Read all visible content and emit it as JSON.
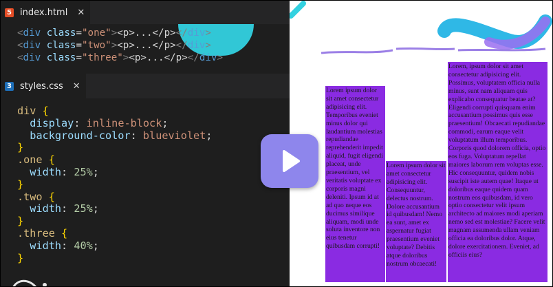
{
  "editor": {
    "tabs": [
      {
        "label": "index.html",
        "icon": "html5-icon",
        "close": "✕"
      },
      {
        "label": "styles.css",
        "icon": "css3-icon",
        "close": "✕"
      }
    ],
    "html_lines": [
      {
        "name": "one",
        "inner": "<p>...</p>"
      },
      {
        "name": "two",
        "inner": "<p>...</p>"
      },
      {
        "name": "three",
        "inner": "<p>...</p>"
      }
    ],
    "css": {
      "div_selector": "div",
      "display_prop": "display",
      "display_value": "inline-block",
      "bg_prop": "background-color",
      "bg_value": "blueviolet",
      "rules": [
        {
          "selector": ".one",
          "prop": "width",
          "value": "25%"
        },
        {
          "selector": ".two",
          "prop": "width",
          "value": "25%"
        },
        {
          "selector": ".three",
          "prop": "width",
          "value": "40%"
        }
      ]
    }
  },
  "preview": {
    "box_color": "#8a2be2",
    "boxes": [
      {
        "text": "Lorem ipsum dolor sit amet consectetur adipisicing elit. Temporibus eveniet minus dolor qui laudantium molestias repudiandae reprehenderit impedit aliquid, fugit eligendi placeat, unde praesentium, vel veritatis voluptate ex corporis magni deleniti. Ipsum id at ad quo neque eos ducimus similique aliquam, modi unde soluta inventore non eius tenetur quibusdam corrupti!"
      },
      {
        "text": "Lorem ipsum dolor sit amet consectetur adipisicing elit. Consequuntur, delectus nostrum. Dolore accusantium id quibusdam! Nemo ea sunt, amet ex aspernatur fugiat praesentium eveniet voluptate? Debitis atque doloribus nostrum obcaecati!"
      },
      {
        "text": "Lorem, ipsum dolor sit amet consectetur adipisicing elit. Possimus, voluptatem officia nulla minus, sunt nam aliquam quis explicabo consequatur beatae at? Eligendi corrupti quisquam enim accusantium possimus quis esse praesentium! Obcaecati repudiandae commodi, earum eaque velit voluptatum illum temporibus. Corporis quod dolorem officia, optio eos fuga. Voluptatum repellat maiores laborum rem voluptas esse. Hic consequuntur, quidem nobis suscipit iste autem quae! Itaque ut doloribus eaque quidem quam nostrum eos quibusdam, id vero optio consectetur velit ipsum architecto ad maiores modi aperiam nemo sed est molestiae? Facere velit magnam assumenda ullam veniam officia ea doloribus dolor. Atque, dolore exercitationem. Eveniet, ad officiis eius?"
      }
    ]
  },
  "play_button": {
    "icon": "play-icon",
    "color": "#8e86ec"
  }
}
